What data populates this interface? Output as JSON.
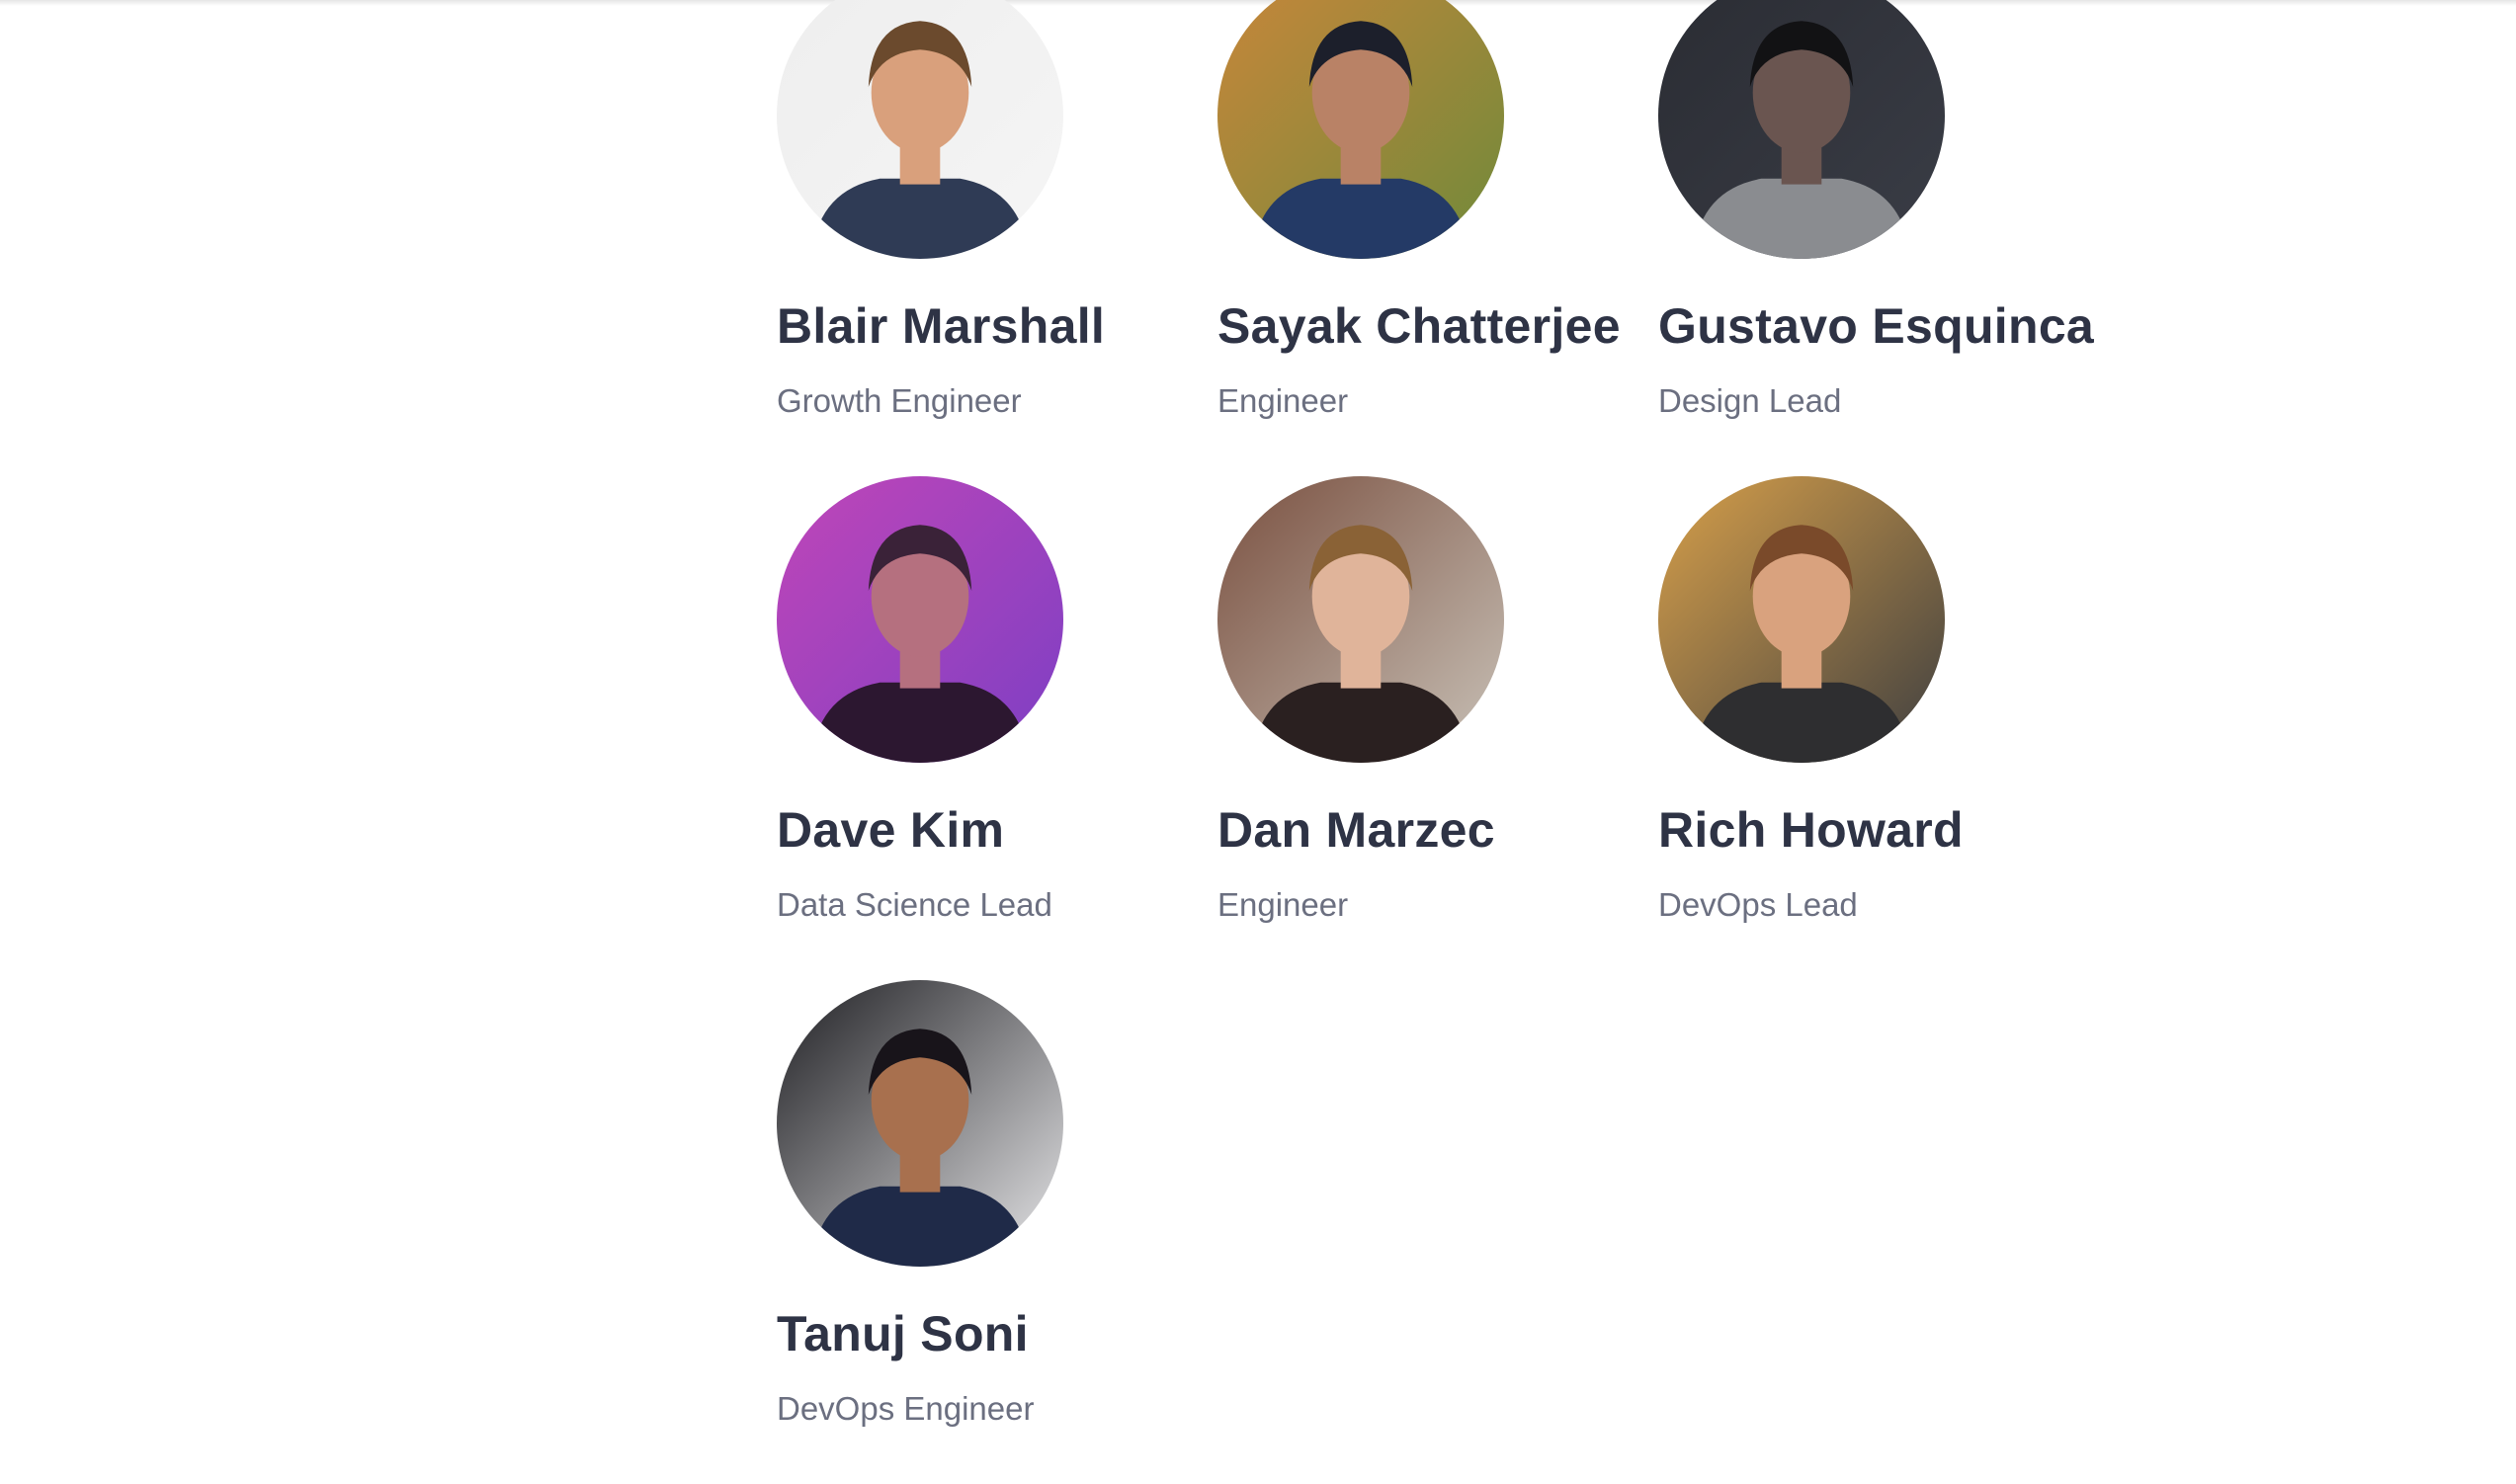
{
  "team": {
    "members": [
      {
        "name": "Blair Marshall",
        "role": "Growth Engineer",
        "avatar": {
          "bg": "#eeeeee",
          "bg2": "#f5f5f5",
          "skin": "#d9a07c",
          "hair": "#6b4a2d",
          "shirt": "#2f3b55"
        }
      },
      {
        "name": "Sayak Chatterjee",
        "role": "Engineer",
        "avatar": {
          "bg": "#c9863a",
          "bg2": "#6f8a3a",
          "skin": "#b98266",
          "hair": "#1c1f2b",
          "shirt": "#243a66"
        }
      },
      {
        "name": "Gustavo Esquinca",
        "role": "Design Lead",
        "avatar": {
          "bg": "#2a2c33",
          "bg2": "#3a3d46",
          "skin": "#6a5550",
          "hair": "#121214",
          "shirt": "#8a8c90"
        }
      },
      {
        "name": "Dave Kim",
        "role": "Data Science Lead",
        "avatar": {
          "bg": "#c046b8",
          "bg2": "#7d3fc4",
          "skin": "#b5707f",
          "hair": "#3a2238",
          "shirt": "#2c1730"
        }
      },
      {
        "name": "Dan Marzec",
        "role": "Engineer",
        "avatar": {
          "bg": "#7a5040",
          "bg2": "#c9c2b8",
          "skin": "#e0b49a",
          "hair": "#8a6236",
          "shirt": "#2a2020"
        }
      },
      {
        "name": "Rich Howard",
        "role": "DevOps Lead",
        "avatar": {
          "bg": "#d8a04a",
          "bg2": "#3d3e40",
          "skin": "#d9a27e",
          "hair": "#7a4a2a",
          "shirt": "#2e2e30"
        }
      },
      {
        "name": "Tanuj Soni",
        "role": "DevOps Engineer",
        "avatar": {
          "bg": "#1e1e22",
          "bg2": "#e8e8ea",
          "skin": "#a8704e",
          "hair": "#18141a",
          "shirt": "#1f2a48"
        }
      }
    ]
  }
}
